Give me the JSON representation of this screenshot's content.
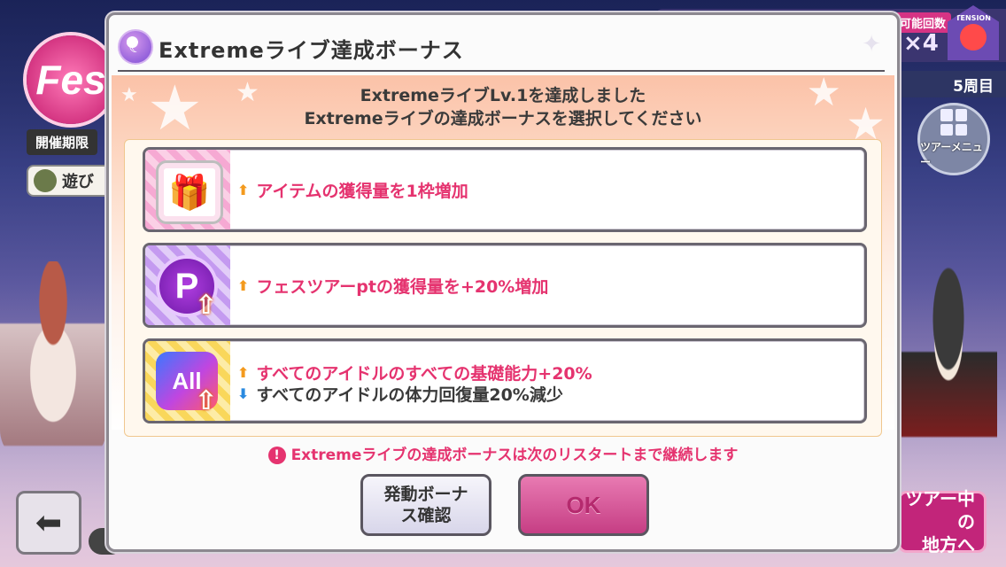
{
  "background": {
    "logo": "Fes",
    "period_label": "開催期限",
    "play_label": "遊び",
    "count_label": "可能回数",
    "count_value": "×4",
    "tension_label": "TENSION",
    "tour_round": "5周目",
    "tour_menu_label": "ツアーメニュー",
    "region_label": "ツアー中の地方へ"
  },
  "modal": {
    "title": "Extremeライブ達成ボーナス",
    "message_line1": "ExtremeライブLv.1を達成しました",
    "message_line2": "Extremeライブの達成ボーナスを選択してください",
    "options": [
      {
        "icon": "gift-icon",
        "lines": [
          {
            "direction": "up",
            "text": "アイテムの獲得量を1枠増加"
          }
        ]
      },
      {
        "icon": "p-point-icon",
        "icon_text": "P",
        "lines": [
          {
            "direction": "up",
            "text": "フェスツアーptの獲得量を+20%増加"
          }
        ]
      },
      {
        "icon": "all-idol-icon",
        "icon_text": "All",
        "lines": [
          {
            "direction": "up",
            "text": "すべてのアイドルのすべての基礎能力+20%"
          },
          {
            "direction": "down",
            "text": "すべてのアイドルの体力回復量20%減少"
          }
        ]
      }
    ],
    "notice": "Extremeライブの達成ボーナスは次のリスタートまで継続します",
    "confirm_button": "発動ボーナス確認",
    "ok_button": "OK"
  },
  "colors": {
    "accent_pink": "#e5336f",
    "up_arrow": "#f39a1e",
    "down_arrow": "#2a8ae0"
  }
}
